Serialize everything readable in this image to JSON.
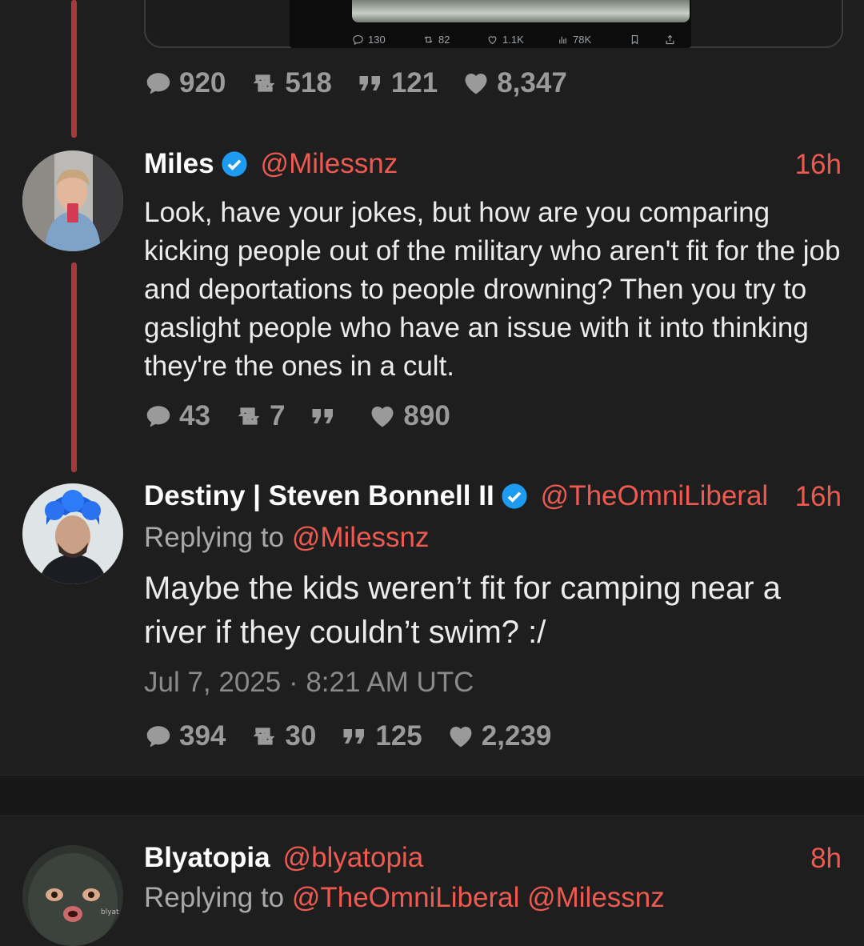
{
  "embed_stats": {
    "replies": "130",
    "retweets": "82",
    "likes": "1.1K",
    "views": "78K"
  },
  "top_stats": {
    "replies": "920",
    "retweets": "518",
    "quotes": "121",
    "likes": "8,347"
  },
  "tweets": [
    {
      "name": "Miles",
      "handle": "@Milessnz",
      "time": "16h",
      "text": "Look, have your jokes, but how are you comparing kicking people out of the military who aren't fit for the job and deportations to people drowning? Then you try to gaslight people who have an issue with it into thinking they're the ones in a cult.",
      "stats": {
        "replies": "43",
        "retweets": "7",
        "quotes": "",
        "likes": "890"
      }
    },
    {
      "name": "Destiny | Steven Bonnell II",
      "handle": "@TheOmniLiberal",
      "time": "16h",
      "replying_label": "Replying to",
      "replying_to": "@Milessnz",
      "text": "Maybe the kids weren’t fit for camping near a river if they couldn’t swim? :/",
      "date": "Jul 7, 2025 · 8:21 AM UTC",
      "stats": {
        "replies": "394",
        "retweets": "30",
        "quotes": "125",
        "likes": "2,239"
      }
    },
    {
      "name": "Blyatopia",
      "handle": "@blyatopia",
      "time": "8h",
      "replying_label": "Replying to",
      "replying_to": "@TheOmniLiberal @Milessnz",
      "avatar_text": "blyat"
    }
  ],
  "colors": {
    "accent": "#ef5a50",
    "thread_line": "#a8393b",
    "background": "#1e1e1e",
    "verified": "#1d9bf0"
  }
}
